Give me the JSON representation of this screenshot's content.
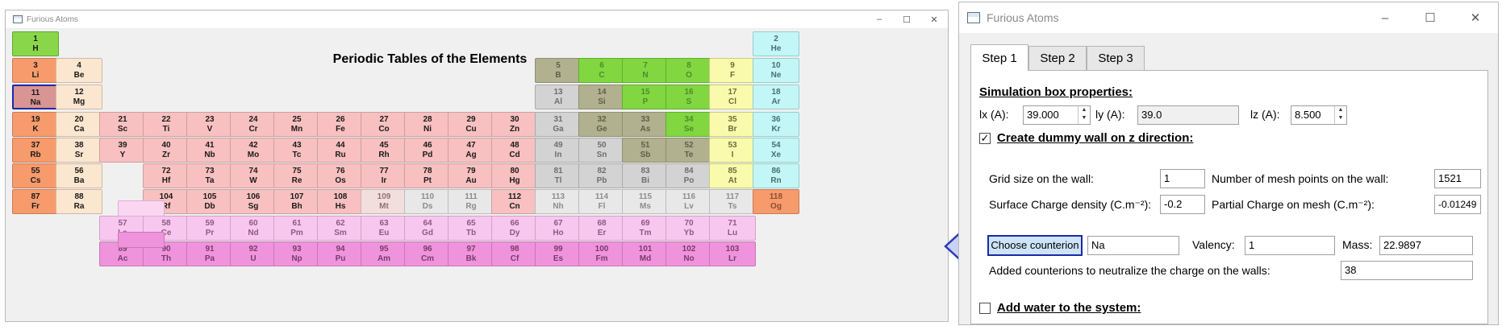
{
  "periodic_window": {
    "title": "Furious Atoms",
    "controls": {
      "minimize": "–",
      "maximize": "☐",
      "close": "✕"
    },
    "heading": "Periodic Tables of the Elements",
    "elements": [
      {
        "n": "1",
        "s": "H",
        "g": 1,
        "p": 1,
        "cat": "hl"
      },
      {
        "n": "2",
        "s": "He",
        "g": 18,
        "p": 1,
        "cat": "ng"
      },
      {
        "n": "3",
        "s": "Li",
        "g": 1,
        "p": 2,
        "cat": "alk"
      },
      {
        "n": "4",
        "s": "Be",
        "g": 2,
        "p": 2,
        "cat": "ae"
      },
      {
        "n": "5",
        "s": "B",
        "g": 13,
        "p": 2,
        "cat": "ml"
      },
      {
        "n": "6",
        "s": "C",
        "g": 14,
        "p": 2,
        "cat": "nm"
      },
      {
        "n": "7",
        "s": "N",
        "g": 15,
        "p": 2,
        "cat": "nm"
      },
      {
        "n": "8",
        "s": "O",
        "g": 16,
        "p": 2,
        "cat": "nm"
      },
      {
        "n": "9",
        "s": "F",
        "g": 17,
        "p": 2,
        "cat": "hal"
      },
      {
        "n": "10",
        "s": "Ne",
        "g": 18,
        "p": 2,
        "cat": "ng"
      },
      {
        "n": "11",
        "s": "Na",
        "g": 1,
        "p": 3,
        "cat": "alk",
        "selected": true
      },
      {
        "n": "12",
        "s": "Mg",
        "g": 2,
        "p": 3,
        "cat": "ae"
      },
      {
        "n": "13",
        "s": "Al",
        "g": 13,
        "p": 3,
        "cat": "pm"
      },
      {
        "n": "14",
        "s": "Si",
        "g": 14,
        "p": 3,
        "cat": "ml"
      },
      {
        "n": "15",
        "s": "P",
        "g": 15,
        "p": 3,
        "cat": "nm"
      },
      {
        "n": "16",
        "s": "S",
        "g": 16,
        "p": 3,
        "cat": "nm"
      },
      {
        "n": "17",
        "s": "Cl",
        "g": 17,
        "p": 3,
        "cat": "hal"
      },
      {
        "n": "18",
        "s": "Ar",
        "g": 18,
        "p": 3,
        "cat": "ng"
      },
      {
        "n": "19",
        "s": "K",
        "g": 1,
        "p": 4,
        "cat": "alk"
      },
      {
        "n": "20",
        "s": "Ca",
        "g": 2,
        "p": 4,
        "cat": "ae"
      },
      {
        "n": "21",
        "s": "Sc",
        "g": 3,
        "p": 4,
        "cat": "tm"
      },
      {
        "n": "22",
        "s": "Ti",
        "g": 4,
        "p": 4,
        "cat": "tm"
      },
      {
        "n": "23",
        "s": "V",
        "g": 5,
        "p": 4,
        "cat": "tm"
      },
      {
        "n": "24",
        "s": "Cr",
        "g": 6,
        "p": 4,
        "cat": "tm"
      },
      {
        "n": "25",
        "s": "Mn",
        "g": 7,
        "p": 4,
        "cat": "tm"
      },
      {
        "n": "26",
        "s": "Fe",
        "g": 8,
        "p": 4,
        "cat": "tm"
      },
      {
        "n": "27",
        "s": "Co",
        "g": 9,
        "p": 4,
        "cat": "tm"
      },
      {
        "n": "28",
        "s": "Ni",
        "g": 10,
        "p": 4,
        "cat": "tm"
      },
      {
        "n": "29",
        "s": "Cu",
        "g": 11,
        "p": 4,
        "cat": "tm"
      },
      {
        "n": "30",
        "s": "Zn",
        "g": 12,
        "p": 4,
        "cat": "tm"
      },
      {
        "n": "31",
        "s": "Ga",
        "g": 13,
        "p": 4,
        "cat": "pm"
      },
      {
        "n": "32",
        "s": "Ge",
        "g": 14,
        "p": 4,
        "cat": "ml"
      },
      {
        "n": "33",
        "s": "As",
        "g": 15,
        "p": 4,
        "cat": "ml"
      },
      {
        "n": "34",
        "s": "Se",
        "g": 16,
        "p": 4,
        "cat": "nm"
      },
      {
        "n": "35",
        "s": "Br",
        "g": 17,
        "p": 4,
        "cat": "hal"
      },
      {
        "n": "36",
        "s": "Kr",
        "g": 18,
        "p": 4,
        "cat": "ng"
      },
      {
        "n": "37",
        "s": "Rb",
        "g": 1,
        "p": 5,
        "cat": "alk"
      },
      {
        "n": "38",
        "s": "Sr",
        "g": 2,
        "p": 5,
        "cat": "ae"
      },
      {
        "n": "39",
        "s": "Y",
        "g": 3,
        "p": 5,
        "cat": "tm"
      },
      {
        "n": "40",
        "s": "Zr",
        "g": 4,
        "p": 5,
        "cat": "tm"
      },
      {
        "n": "41",
        "s": "Nb",
        "g": 5,
        "p": 5,
        "cat": "tm"
      },
      {
        "n": "42",
        "s": "Mo",
        "g": 6,
        "p": 5,
        "cat": "tm"
      },
      {
        "n": "43",
        "s": "Tc",
        "g": 7,
        "p": 5,
        "cat": "tm"
      },
      {
        "n": "44",
        "s": "Ru",
        "g": 8,
        "p": 5,
        "cat": "tm"
      },
      {
        "n": "45",
        "s": "Rh",
        "g": 9,
        "p": 5,
        "cat": "tm"
      },
      {
        "n": "46",
        "s": "Pd",
        "g": 10,
        "p": 5,
        "cat": "tm"
      },
      {
        "n": "47",
        "s": "Ag",
        "g": 11,
        "p": 5,
        "cat": "tm"
      },
      {
        "n": "48",
        "s": "Cd",
        "g": 12,
        "p": 5,
        "cat": "tm"
      },
      {
        "n": "49",
        "s": "In",
        "g": 13,
        "p": 5,
        "cat": "pm"
      },
      {
        "n": "50",
        "s": "Sn",
        "g": 14,
        "p": 5,
        "cat": "pm"
      },
      {
        "n": "51",
        "s": "Sb",
        "g": 15,
        "p": 5,
        "cat": "ml"
      },
      {
        "n": "52",
        "s": "Te",
        "g": 16,
        "p": 5,
        "cat": "ml"
      },
      {
        "n": "53",
        "s": "I",
        "g": 17,
        "p": 5,
        "cat": "hal"
      },
      {
        "n": "54",
        "s": "Xe",
        "g": 18,
        "p": 5,
        "cat": "ng"
      },
      {
        "n": "55",
        "s": "Cs",
        "g": 1,
        "p": 6,
        "cat": "alk"
      },
      {
        "n": "56",
        "s": "Ba",
        "g": 2,
        "p": 6,
        "cat": "ae"
      },
      {
        "n": "72",
        "s": "Hf",
        "g": 4,
        "p": 6,
        "cat": "tm"
      },
      {
        "n": "73",
        "s": "Ta",
        "g": 5,
        "p": 6,
        "cat": "tm"
      },
      {
        "n": "74",
        "s": "W",
        "g": 6,
        "p": 6,
        "cat": "tm"
      },
      {
        "n": "75",
        "s": "Re",
        "g": 7,
        "p": 6,
        "cat": "tm"
      },
      {
        "n": "76",
        "s": "Os",
        "g": 8,
        "p": 6,
        "cat": "tm"
      },
      {
        "n": "77",
        "s": "Ir",
        "g": 9,
        "p": 6,
        "cat": "tm"
      },
      {
        "n": "78",
        "s": "Pt",
        "g": 10,
        "p": 6,
        "cat": "tm"
      },
      {
        "n": "79",
        "s": "Au",
        "g": 11,
        "p": 6,
        "cat": "tm"
      },
      {
        "n": "80",
        "s": "Hg",
        "g": 12,
        "p": 6,
        "cat": "tm"
      },
      {
        "n": "81",
        "s": "Tl",
        "g": 13,
        "p": 6,
        "cat": "pm"
      },
      {
        "n": "82",
        "s": "Pb",
        "g": 14,
        "p": 6,
        "cat": "pm"
      },
      {
        "n": "83",
        "s": "Bi",
        "g": 15,
        "p": 6,
        "cat": "pm"
      },
      {
        "n": "84",
        "s": "Po",
        "g": 16,
        "p": 6,
        "cat": "pm"
      },
      {
        "n": "85",
        "s": "At",
        "g": 17,
        "p": 6,
        "cat": "hal"
      },
      {
        "n": "86",
        "s": "Rn",
        "g": 18,
        "p": 6,
        "cat": "ng"
      },
      {
        "n": "87",
        "s": "Fr",
        "g": 1,
        "p": 7,
        "cat": "alk"
      },
      {
        "n": "88",
        "s": "Ra",
        "g": 2,
        "p": 7,
        "cat": "ae"
      },
      {
        "n": "104",
        "s": "Rf",
        "g": 4,
        "p": 7,
        "cat": "tm"
      },
      {
        "n": "105",
        "s": "Db",
        "g": 5,
        "p": 7,
        "cat": "tm"
      },
      {
        "n": "106",
        "s": "Sg",
        "g": 6,
        "p": 7,
        "cat": "tm"
      },
      {
        "n": "107",
        "s": "Bh",
        "g": 7,
        "p": 7,
        "cat": "tm"
      },
      {
        "n": "108",
        "s": "Hs",
        "g": 8,
        "p": 7,
        "cat": "tm"
      },
      {
        "n": "109",
        "s": "Mt",
        "g": 9,
        "p": 7,
        "cat": "ttm"
      },
      {
        "n": "110",
        "s": "Ds",
        "g": 10,
        "p": 7,
        "cat": "un"
      },
      {
        "n": "111",
        "s": "Rg",
        "g": 11,
        "p": 7,
        "cat": "un"
      },
      {
        "n": "112",
        "s": "Cn",
        "g": 12,
        "p": 7,
        "cat": "tm"
      },
      {
        "n": "113",
        "s": "Nh",
        "g": 13,
        "p": 7,
        "cat": "un"
      },
      {
        "n": "114",
        "s": "Fl",
        "g": 14,
        "p": 7,
        "cat": "un"
      },
      {
        "n": "115",
        "s": "Ms",
        "g": 15,
        "p": 7,
        "cat": "un"
      },
      {
        "n": "116",
        "s": "Lv",
        "g": 16,
        "p": 7,
        "cat": "un"
      },
      {
        "n": "117",
        "s": "Ts",
        "g": 17,
        "p": 7,
        "cat": "un"
      },
      {
        "n": "118",
        "s": "Og",
        "g": 18,
        "p": 7,
        "cat": "og"
      },
      {
        "n": "57",
        "s": "La",
        "g": 3,
        "p": 8,
        "cat": "la"
      },
      {
        "n": "58",
        "s": "Ce",
        "g": 4,
        "p": 8,
        "cat": "la"
      },
      {
        "n": "59",
        "s": "Pr",
        "g": 5,
        "p": 8,
        "cat": "la"
      },
      {
        "n": "60",
        "s": "Nd",
        "g": 6,
        "p": 8,
        "cat": "la"
      },
      {
        "n": "61",
        "s": "Pm",
        "g": 7,
        "p": 8,
        "cat": "la"
      },
      {
        "n": "62",
        "s": "Sm",
        "g": 8,
        "p": 8,
        "cat": "la"
      },
      {
        "n": "63",
        "s": "Eu",
        "g": 9,
        "p": 8,
        "cat": "la"
      },
      {
        "n": "64",
        "s": "Gd",
        "g": 10,
        "p": 8,
        "cat": "la"
      },
      {
        "n": "65",
        "s": "Tb",
        "g": 11,
        "p": 8,
        "cat": "la"
      },
      {
        "n": "66",
        "s": "Dy",
        "g": 12,
        "p": 8,
        "cat": "la"
      },
      {
        "n": "67",
        "s": "Ho",
        "g": 13,
        "p": 8,
        "cat": "la"
      },
      {
        "n": "68",
        "s": "Er",
        "g": 14,
        "p": 8,
        "cat": "la"
      },
      {
        "n": "69",
        "s": "Tm",
        "g": 15,
        "p": 8,
        "cat": "la"
      },
      {
        "n": "70",
        "s": "Yb",
        "g": 16,
        "p": 8,
        "cat": "la"
      },
      {
        "n": "71",
        "s": "Lu",
        "g": 17,
        "p": 8,
        "cat": "la"
      },
      {
        "n": "89",
        "s": "Ac",
        "g": 3,
        "p": 9,
        "cat": "ac"
      },
      {
        "n": "90",
        "s": "Th",
        "g": 4,
        "p": 9,
        "cat": "ac"
      },
      {
        "n": "91",
        "s": "Pa",
        "g": 5,
        "p": 9,
        "cat": "ac"
      },
      {
        "n": "92",
        "s": "U",
        "g": 6,
        "p": 9,
        "cat": "ac"
      },
      {
        "n": "93",
        "s": "Np",
        "g": 7,
        "p": 9,
        "cat": "ac"
      },
      {
        "n": "94",
        "s": "Pu",
        "g": 8,
        "p": 9,
        "cat": "ac"
      },
      {
        "n": "95",
        "s": "Am",
        "g": 9,
        "p": 9,
        "cat": "ac"
      },
      {
        "n": "96",
        "s": "Cm",
        "g": 10,
        "p": 9,
        "cat": "ac"
      },
      {
        "n": "97",
        "s": "Bk",
        "g": 11,
        "p": 9,
        "cat": "ac"
      },
      {
        "n": "98",
        "s": "Cf",
        "g": 12,
        "p": 9,
        "cat": "ac"
      },
      {
        "n": "99",
        "s": "Es",
        "g": 13,
        "p": 9,
        "cat": "ac"
      },
      {
        "n": "100",
        "s": "Fm",
        "g": 14,
        "p": 9,
        "cat": "ac"
      },
      {
        "n": "101",
        "s": "Md",
        "g": 15,
        "p": 9,
        "cat": "ac"
      },
      {
        "n": "102",
        "s": "No",
        "g": 16,
        "p": 9,
        "cat": "ac"
      },
      {
        "n": "103",
        "s": "Lr",
        "g": 17,
        "p": 9,
        "cat": "ac"
      }
    ]
  },
  "form_window": {
    "title": "Furious Atoms",
    "controls": {
      "minimize": "–",
      "maximize": "☐",
      "close": "✕"
    },
    "tabs": [
      {
        "label": "Step 1",
        "active": true
      },
      {
        "label": "Step 2",
        "active": false
      },
      {
        "label": "Step 3",
        "active": false
      }
    ],
    "sim_box_heading": "Simulation box  properties:",
    "lx": {
      "label": "lx (A):",
      "value": "39.000"
    },
    "ly": {
      "label": "ly (A):",
      "value": "39.0"
    },
    "lz": {
      "label": "lz (A):",
      "value": "8.500"
    },
    "dummy_wall": {
      "label": "Create dummy wall on z direction:",
      "checked": true
    },
    "grid_size": {
      "label": "Grid size on the wall:",
      "value": "1"
    },
    "mesh_points": {
      "label": "Number of mesh points on the wall:",
      "value": "1521"
    },
    "surface_charge": {
      "label": "Surface Charge density (C.m⁻²):",
      "value": "-0.2"
    },
    "partial_charge": {
      "label": "Partial Charge on mesh (C.m⁻²):",
      "value": "-0.01249"
    },
    "counterion": {
      "button": "Choose counterion",
      "value": "Na"
    },
    "valency": {
      "label": "Valency:",
      "value": "1"
    },
    "mass": {
      "label": "Mass:",
      "value": "22.9897"
    },
    "added_counterions": {
      "label": "Added counterions to neutralize the charge on the walls:",
      "value": "38"
    },
    "add_water": {
      "label": "Add water to the system:",
      "checked": false
    },
    "checkmark": "✓"
  },
  "spin_arrows": {
    "up": "▲",
    "down": "▼"
  }
}
